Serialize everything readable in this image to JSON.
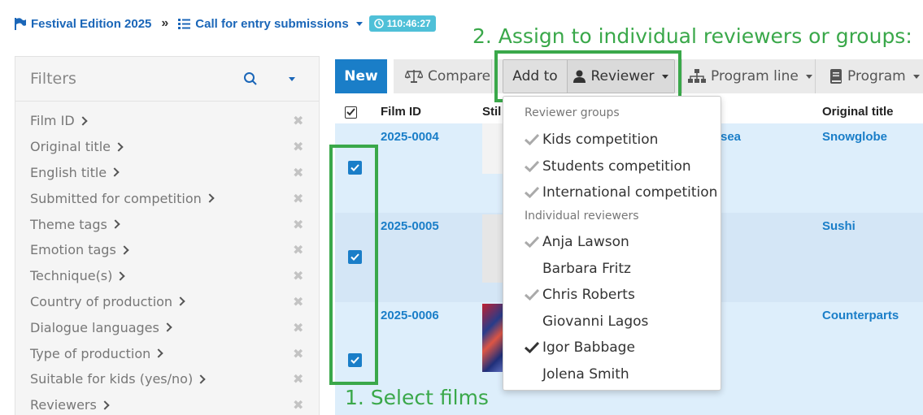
{
  "breadcrumb": {
    "edition": "Festival Edition 2025",
    "separator": "»",
    "section": "Call for entry submissions",
    "timer": "110:46:27"
  },
  "annotations": {
    "step1": "1. Select films",
    "step2": "2. Assign to individual reviewers or groups:"
  },
  "sidebar": {
    "title": "Filters",
    "filters": [
      "Film ID",
      "Original title",
      "English title",
      "Submitted for competition",
      "Theme tags",
      "Emotion tags",
      "Technique(s)",
      "Country of production",
      "Dialogue languages",
      "Type of production",
      "Suitable for kids (yes/no)",
      "Reviewers"
    ]
  },
  "toolbar": {
    "new_label": "New",
    "compare_label": "Compare",
    "add_to_label": "Add to",
    "reviewer_label": "Reviewer",
    "program_line_label": "Program line",
    "program_label": "Program"
  },
  "table": {
    "headers": {
      "film_id": "Film ID",
      "still": "Stil",
      "original_title": "Original title"
    },
    "rows": [
      {
        "film_id": "2025-0004",
        "english_fragment": "sea",
        "original_title": "Snowglobe",
        "checked": true
      },
      {
        "film_id": "2025-0005",
        "english_fragment": "",
        "original_title": "Sushi",
        "checked": true
      },
      {
        "film_id": "2025-0006",
        "english_fragment": "",
        "original_title": "Counterparts",
        "checked": true
      }
    ]
  },
  "dropdown": {
    "groups_header": "Reviewer groups",
    "groups": [
      {
        "label": "Kids competition",
        "state": "partial"
      },
      {
        "label": "Students competition",
        "state": "partial"
      },
      {
        "label": "International competition",
        "state": "partial"
      }
    ],
    "individuals_header": "Individual reviewers",
    "individuals": [
      {
        "label": "Anja Lawson",
        "state": "partial"
      },
      {
        "label": "Barbara Fritz",
        "state": "none"
      },
      {
        "label": "Chris Roberts",
        "state": "partial"
      },
      {
        "label": "Giovanni Lagos",
        "state": "none"
      },
      {
        "label": "Igor Babbage",
        "state": "full"
      },
      {
        "label": "Jolena Smith",
        "state": "none"
      }
    ]
  },
  "colors": {
    "brand_blue": "#1a7ec8",
    "link_blue": "#1a66b8",
    "timer_teal": "#4fc0d8",
    "annotation_green": "#3aa84a",
    "partial_check": "#aaaaaa",
    "full_check": "#333333"
  }
}
